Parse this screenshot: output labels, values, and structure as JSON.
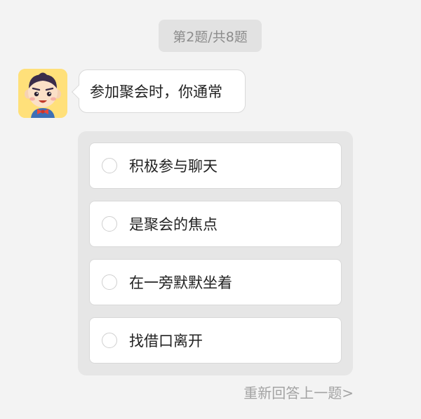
{
  "progress": {
    "text": "第2题/共8题",
    "current": 2,
    "total": 8
  },
  "question": {
    "avatar_icon": "cartoon-boy-avatar-icon",
    "text": "参加聚会时，你通常"
  },
  "options": [
    {
      "label": "积极参与聊天",
      "selected": false
    },
    {
      "label": "是聚会的焦点",
      "selected": false
    },
    {
      "label": "在一旁默默坐着",
      "selected": false
    },
    {
      "label": "找借口离开",
      "selected": false
    }
  ],
  "footer": {
    "redo_label": "重新回答上一题>"
  },
  "colors": {
    "background": "#f3f3f3",
    "pill_bg": "#e2e2e2",
    "panel_bg": "#e6e6e6",
    "avatar_bg": "#ffe07a",
    "muted_text": "#a3a3a3"
  }
}
